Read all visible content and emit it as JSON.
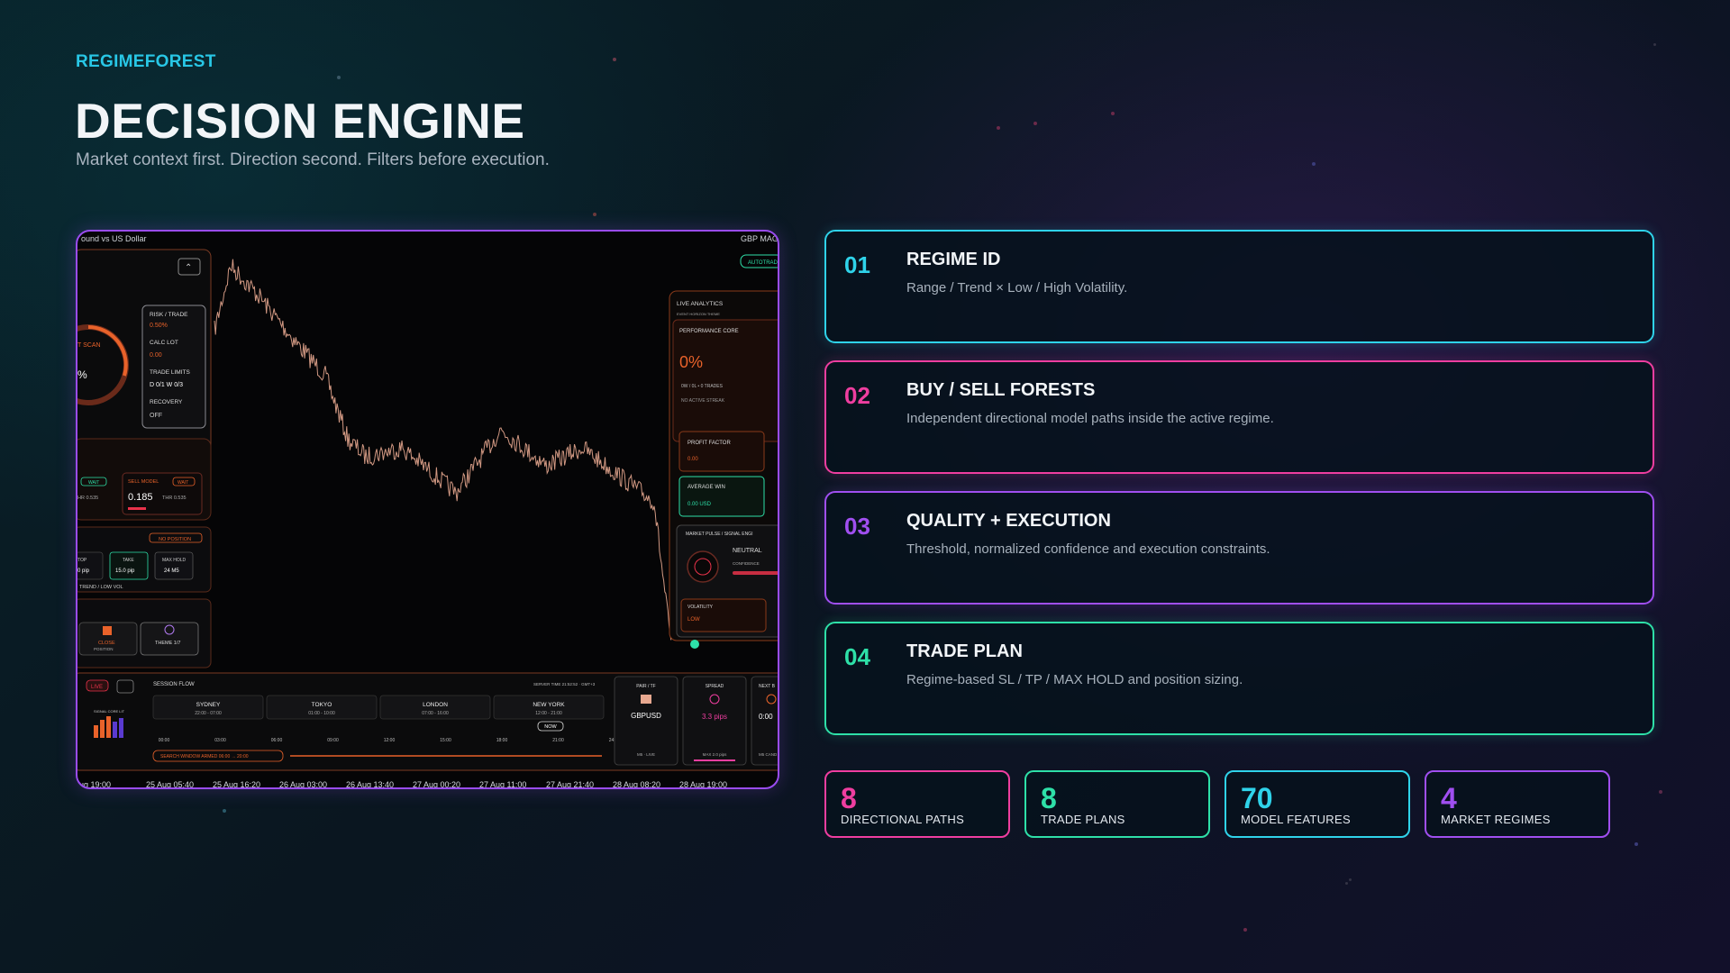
{
  "header": {
    "brand": "REGIMEFOREST",
    "title": "DECISION ENGINE",
    "subtitle": "Market context first. Direction second. Filters before execution."
  },
  "screenshot": {
    "pair_title": "ound vs US Dollar",
    "top_right_label": "GBP MAG",
    "autotrade": "AUTOTRAD",
    "left_panel": {
      "risk_trade_label": "RISK / TRADE",
      "risk_trade_value": "0.50%",
      "calc_lot_label": "CALC LOT",
      "calc_lot_value": "0.00",
      "trade_limits_label": "TRADE LIMITS",
      "trade_limits_value": "D 0/1   W 0/3",
      "recovery_label": "RECOVERY",
      "recovery_value": "OFF",
      "scan_label": "T SCAN",
      "scan_pct": "%",
      "sell_model_label": "SELL MODEL",
      "sell_model_value": "0.185",
      "sell_thr": "THR 0.535",
      "buy_thr": "HR 0.535",
      "wait_1": "WAIT",
      "wait_2": "WAIT",
      "no_position": "NO POSITION",
      "stop_label": "TOP",
      "stop_value": "0 pip",
      "take_label": "TAKE",
      "take_value": "15.0 pip",
      "max_hold_label": "MAX HOLD",
      "max_hold_value": "24 M5",
      "regime_tag": "TREND / LOW VOL",
      "close_label": "CLOSE",
      "close_sub": "POSITION",
      "theme_label": "THEME 1/7"
    },
    "right_panel": {
      "live_analytics": "LIVE ANALYTICS",
      "horizon": "EVENT HORIZON THEME",
      "performance_core": "PERFORMANCE CORE",
      "perf_value": "0%",
      "perf_sub": "0W / 0L  •  0 TRADES",
      "streak": "NO ACTIVE STREAK",
      "profit_factor_label": "PROFIT FACTOR",
      "profit_factor_value": "0.00",
      "avg_win_label": "AVERAGE WIN",
      "avg_win_value": "0.00 USD",
      "pulse_label": "MARKET PULSE / SIGNAL ENGI",
      "pulse_state": "NEUTRAL",
      "confidence": "CONFIDENCE",
      "volatility_label": "VOLATILITY",
      "volatility_value": "LOW"
    },
    "bottom_panel": {
      "live": "LIVE",
      "signal_label": "SIGNAL CORE LIT",
      "session_flow": "SESSION FLOW",
      "server_time": "SERVER TIME 21:52:52 · GMT+3",
      "sessions": [
        {
          "name": "SYDNEY",
          "hours": "22:00 - 07:00"
        },
        {
          "name": "TOKYO",
          "hours": "01:00 - 10:00"
        },
        {
          "name": "LONDON",
          "hours": "07:00 - 16:00"
        },
        {
          "name": "NEW YORK",
          "hours": "12:00 - 21:00"
        }
      ],
      "now": "NOW",
      "hours": [
        "00:00",
        "03:00",
        "06:00",
        "09:00",
        "12:00",
        "15:00",
        "18:00",
        "21:00",
        "24:00"
      ],
      "search_window": "SEARCH WINDOW ARMED   06:00  →  20:00",
      "pair_tf_label": "PAIR / TF",
      "pair_value": "GBPUSD",
      "pair_sub": "M5 · LIVE",
      "spread_label": "SPREAD",
      "spread_value": "3.3 pips",
      "spread_sub": "MAX 2.0 pips",
      "next_label": "NEXT B",
      "next_value": "0:00",
      "next_sub": "M5 CAND"
    },
    "time_axis": [
      "ug 19:00",
      "25 Aug 05:40",
      "25 Aug 16:20",
      "26 Aug 03:00",
      "26 Aug 13:40",
      "27 Aug 00:20",
      "27 Aug 11:00",
      "27 Aug 21:40",
      "28 Aug 08:20",
      "28 Aug 19:00"
    ]
  },
  "cards": [
    {
      "num": "01",
      "title": "REGIME ID",
      "desc": "Range / Trend × Low / High Volatility.",
      "color": "#2fd3ea"
    },
    {
      "num": "02",
      "title": "BUY / SELL FORESTS",
      "desc": "Independent directional model paths inside the active regime.",
      "color": "#ef3ea0"
    },
    {
      "num": "03",
      "title": "QUALITY + EXECUTION",
      "desc": "Threshold, normalized confidence and execution constraints.",
      "color": "#a04ff0"
    },
    {
      "num": "04",
      "title": "TRADE PLAN",
      "desc": "Regime-based SL / TP / MAX HOLD and position sizing.",
      "color": "#2ee0a8"
    }
  ],
  "stats": [
    {
      "value": "8",
      "label": "DIRECTIONAL PATHS",
      "color": "#ef3ea0"
    },
    {
      "value": "8",
      "label": "TRADE PLANS",
      "color": "#2ee0a8"
    },
    {
      "value": "70",
      "label": "MODEL FEATURES",
      "color": "#2fd3ea"
    },
    {
      "value": "4",
      "label": "MARKET REGIMES",
      "color": "#a04ff0"
    }
  ]
}
